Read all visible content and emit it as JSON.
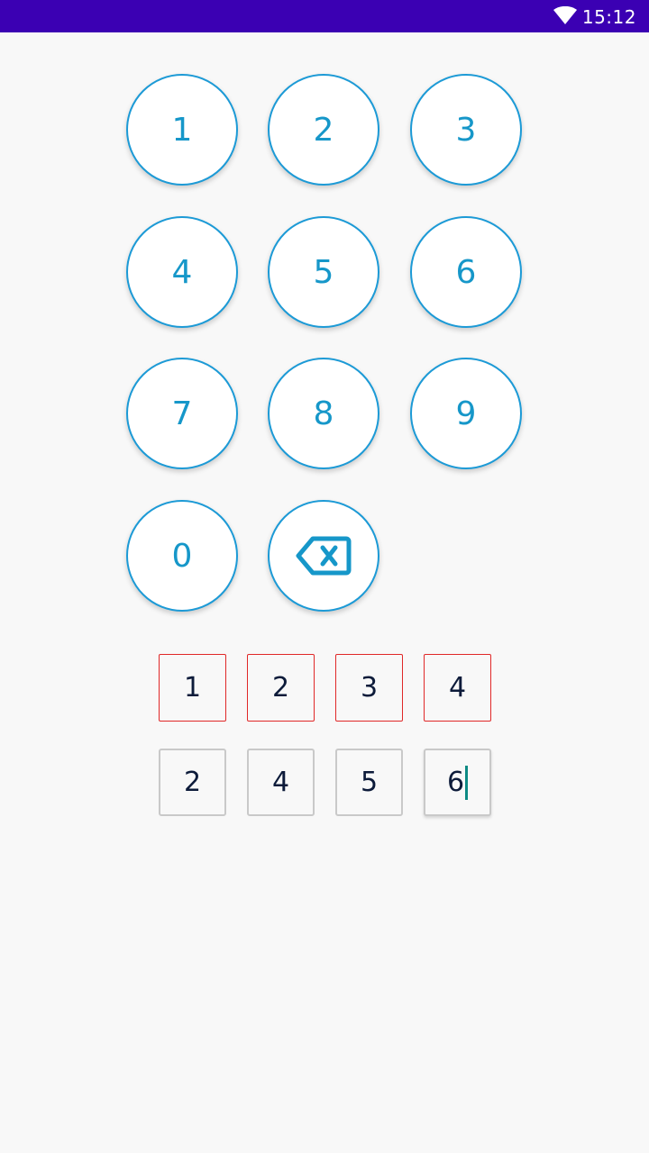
{
  "status_bar": {
    "time": "15:12",
    "wifi_icon": "wifi-icon",
    "background": "#3b00b3"
  },
  "keypad": {
    "keys": [
      "1",
      "2",
      "3",
      "4",
      "5",
      "6",
      "7",
      "8",
      "9",
      "0"
    ],
    "backspace_icon": "backspace-icon",
    "accent": "#1697c9"
  },
  "pin_rows": {
    "first": {
      "state": "error",
      "border_color": "#e02828",
      "digits": [
        "1",
        "2",
        "3",
        "4"
      ]
    },
    "second": {
      "state": "focused",
      "border_color": "#c9c9c9",
      "digits": [
        "2",
        "4",
        "5",
        "6"
      ]
    }
  }
}
